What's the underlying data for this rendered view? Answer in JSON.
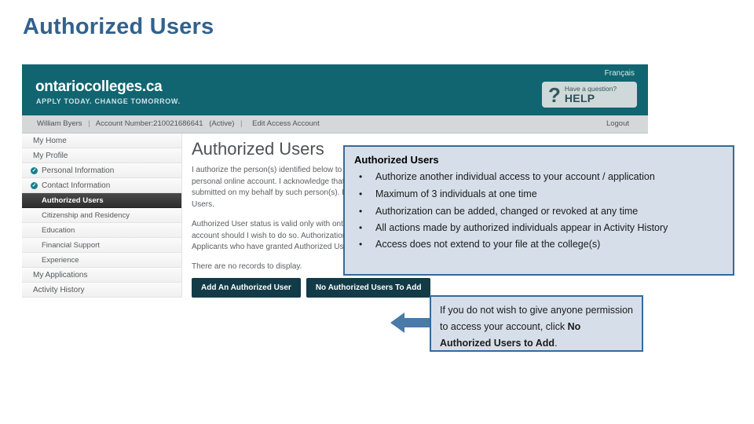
{
  "slide": {
    "title": "Authorized Users",
    "title_color": "#31628f"
  },
  "screenshot": {
    "brand": {
      "name": "ontariocolleges.ca",
      "tagline": "APPLY TODAY. CHANGE TOMORROW.",
      "bar_color": "#106570"
    },
    "language_link": "Français",
    "help": {
      "icon": "question-mark-icon",
      "small_label": "Have a question?",
      "big_label": "HELP"
    },
    "account_bar": {
      "user_name": "William Byers",
      "account_number": "Account Number:210021686641",
      "status": "(Active)",
      "edit_link": "Edit Access Account",
      "logout_label": "Logout"
    },
    "sidebar": {
      "items": [
        {
          "label": "My Home",
          "level": "top",
          "checked": false,
          "active": false
        },
        {
          "label": "My Profile",
          "level": "top",
          "checked": false,
          "active": false
        },
        {
          "label": "Personal Information",
          "level": "sub",
          "checked": true,
          "active": false
        },
        {
          "label": "Contact Information",
          "level": "sub",
          "checked": true,
          "active": false
        },
        {
          "label": "Authorized Users",
          "level": "sub",
          "checked": false,
          "active": true
        },
        {
          "label": "Citizenship and Residency",
          "level": "sub",
          "checked": false,
          "active": false
        },
        {
          "label": "Education",
          "level": "sub",
          "checked": false,
          "active": false
        },
        {
          "label": "Financial Support",
          "level": "sub",
          "checked": false,
          "active": false
        },
        {
          "label": "Experience",
          "level": "sub",
          "checked": false,
          "active": false
        },
        {
          "label": "My Applications",
          "level": "top",
          "checked": false,
          "active": false
        },
        {
          "label": "Activity History",
          "level": "top",
          "checked": false,
          "active": false
        }
      ],
      "check_icon": "check-circle-icon"
    },
    "main": {
      "heading": "Authorized Users",
      "paragraph_1": "I authorize the person(s) identified below to act on my behalf and grant them 'Full Access' access or 'Read Only' access to my personal online account. I acknowledge that I retain full responsibility for the accuracy and integrity of the information submitted on my behalf by such person(s). I release OCAS and its partners from any and all liability relating to such Authorized Users.",
      "paragraph_2": "Authorized User status is valid only with ontariocolleges.ca and may be revoked by me at any time through the secure online account should I wish to do so. Authorization expires at the end of the application cycle for which the user was authorized. Applicants who have granted Authorized User access may only access their account by logging into the online account.",
      "no_records": "There are no records to display.",
      "buttons": [
        "Add An Authorized User",
        "No Authorized Users To Add"
      ]
    }
  },
  "callouts": {
    "bullets": {
      "title": "Authorized Users",
      "items": [
        "Authorize another individual access to your account / application",
        "Maximum of 3 individuals at one time",
        "Authorization can be added, changed or revoked at any time",
        "All actions made by authorized individuals appear in Activity History",
        "Access does not extend to your file at the college(s)"
      ],
      "fill_color": "#d6dfe9",
      "border_color": "#36699b"
    },
    "note": {
      "text_lead": "If you do not wish to give anyone permission to access your account,  click ",
      "text_bold": "No Authorized Users to Add",
      "text_tail": ".",
      "fill_color": "#d6dfe9",
      "border_color": "#36699b"
    },
    "arrow": {
      "icon": "arrow-left-icon",
      "color": "#4a7aa8"
    }
  }
}
